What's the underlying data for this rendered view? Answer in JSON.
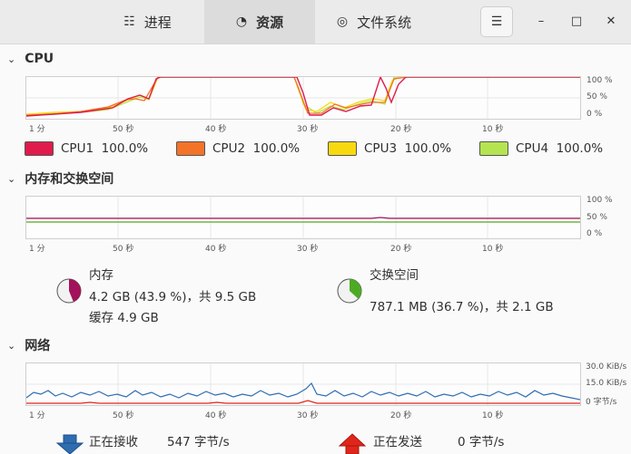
{
  "tabs": [
    {
      "label": "进程",
      "icon": "list-icon"
    },
    {
      "label": "资源",
      "icon": "speedometer-icon"
    },
    {
      "label": "文件系统",
      "icon": "disk-icon"
    }
  ],
  "cpu": {
    "title": "CPU",
    "x_ticks": [
      "1 分",
      "50 秒",
      "40 秒",
      "30 秒",
      "20 秒",
      "10 秒"
    ],
    "y_ticks": [
      "100 %",
      "50 %",
      "0 %"
    ],
    "legend": [
      {
        "name": "CPU1",
        "value": "100.0%",
        "color": "#e01b4c"
      },
      {
        "name": "CPU2",
        "value": "100.0%",
        "color": "#f37329"
      },
      {
        "name": "CPU3",
        "value": "100.0%",
        "color": "#f8d90f"
      },
      {
        "name": "CPU4",
        "value": "100.0%",
        "color": "#b5e451"
      }
    ]
  },
  "memory": {
    "title": "内存和交换空间",
    "x_ticks": [
      "1 分",
      "50 秒",
      "40 秒",
      "30 秒",
      "20 秒",
      "10 秒"
    ],
    "y_ticks": [
      "100 %",
      "50 %",
      "0 %"
    ],
    "ram": {
      "label": "内存",
      "usage": "4.2 GB (43.9 %)，共 9.5 GB",
      "cache": "缓存 4.9 GB",
      "color": "#a3135b",
      "fraction": 0.439
    },
    "swap": {
      "label": "交换空间",
      "usage": "787.1 MB (36.7 %)，共 2.1 GB",
      "color": "#4eaa25",
      "fraction": 0.367
    }
  },
  "network": {
    "title": "网络",
    "x_ticks": [
      "1 分",
      "50 秒",
      "40 秒",
      "30 秒",
      "20 秒",
      "10 秒"
    ],
    "y_ticks": [
      "30.0 KiB/s",
      "15.0 KiB/s",
      "0 字节/s"
    ],
    "receiving": {
      "label": "正在接收",
      "value": "547 字节/s",
      "color": "#2f6cb0"
    },
    "sending": {
      "label": "正在发送",
      "value": "0 字节/s",
      "color": "#e0261b"
    }
  },
  "colors": {
    "accent": "#e01b4c"
  }
}
